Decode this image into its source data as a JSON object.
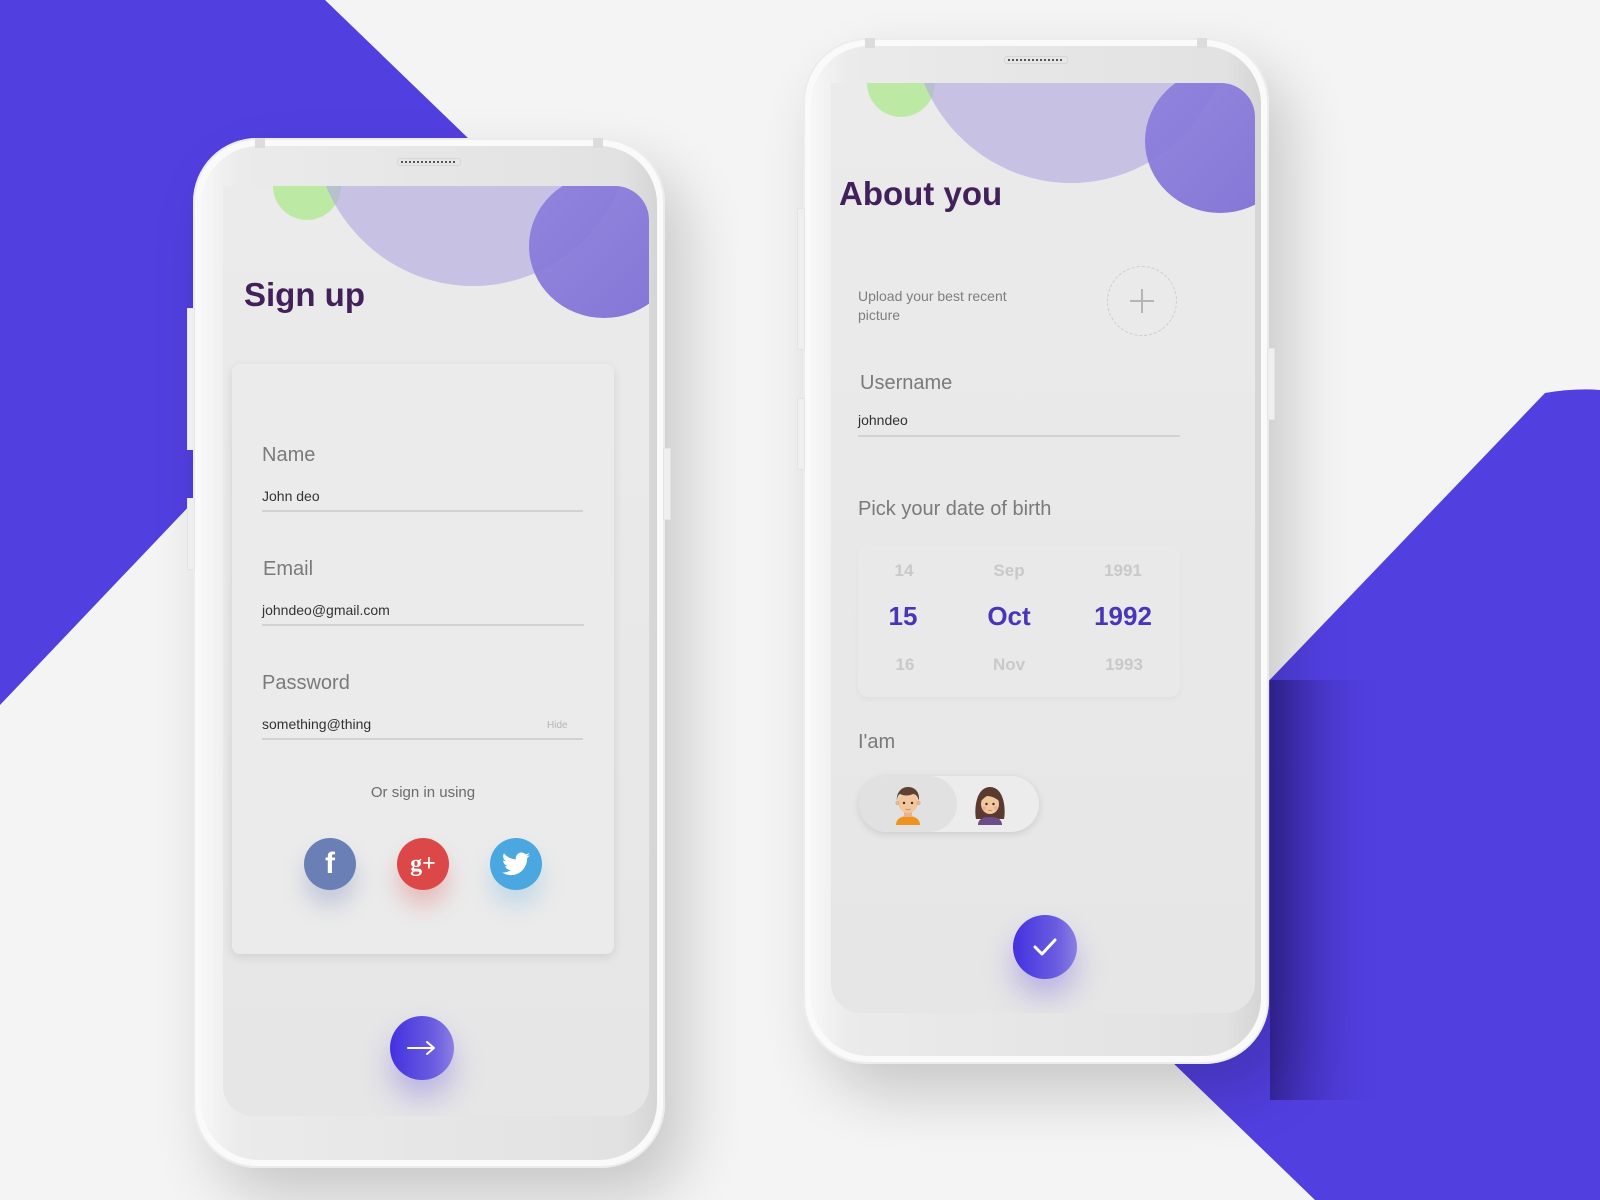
{
  "colors": {
    "brand": "#523fe0",
    "title": "#42215a",
    "selected": "#4a34b8",
    "facebook": "#6a7fb6",
    "google": "#dc4848",
    "twitter": "#4aa7e0",
    "accent_green": "#b9eaa0"
  },
  "signup": {
    "title": "Sign up",
    "fields": [
      {
        "label": "Name",
        "value": "John deo"
      },
      {
        "label": "Email",
        "value": "johndeo@gmail.com"
      },
      {
        "label": "Password",
        "value": "something@thing",
        "action": "Hide"
      }
    ],
    "social_prompt": "Or sign in using",
    "social": [
      {
        "name": "Facebook",
        "icon": "facebook-icon",
        "glyph": "f"
      },
      {
        "name": "Google Plus",
        "icon": "google-plus-icon",
        "glyph": "g+"
      },
      {
        "name": "Twitter",
        "icon": "twitter-icon"
      }
    ],
    "next_icon": "arrow-right-icon"
  },
  "about": {
    "title": "About you",
    "upload_text": "Upload your best recent picture",
    "upload_icon": "plus-icon",
    "username": {
      "label": "Username",
      "value": "johndeo"
    },
    "dob": {
      "label": "Pick your date of birth",
      "day": {
        "prev": "14",
        "selected": "15",
        "next": "16"
      },
      "month": {
        "prev": "Sep",
        "selected": "Oct",
        "next": "Nov"
      },
      "year": {
        "prev": "1991",
        "selected": "1992",
        "next": "1993"
      }
    },
    "gender": {
      "label": "I'am",
      "options": [
        {
          "name": "male",
          "icon": "male-avatar-icon",
          "selected": true
        },
        {
          "name": "female",
          "icon": "female-avatar-icon",
          "selected": false
        }
      ]
    },
    "confirm_icon": "check-icon"
  }
}
